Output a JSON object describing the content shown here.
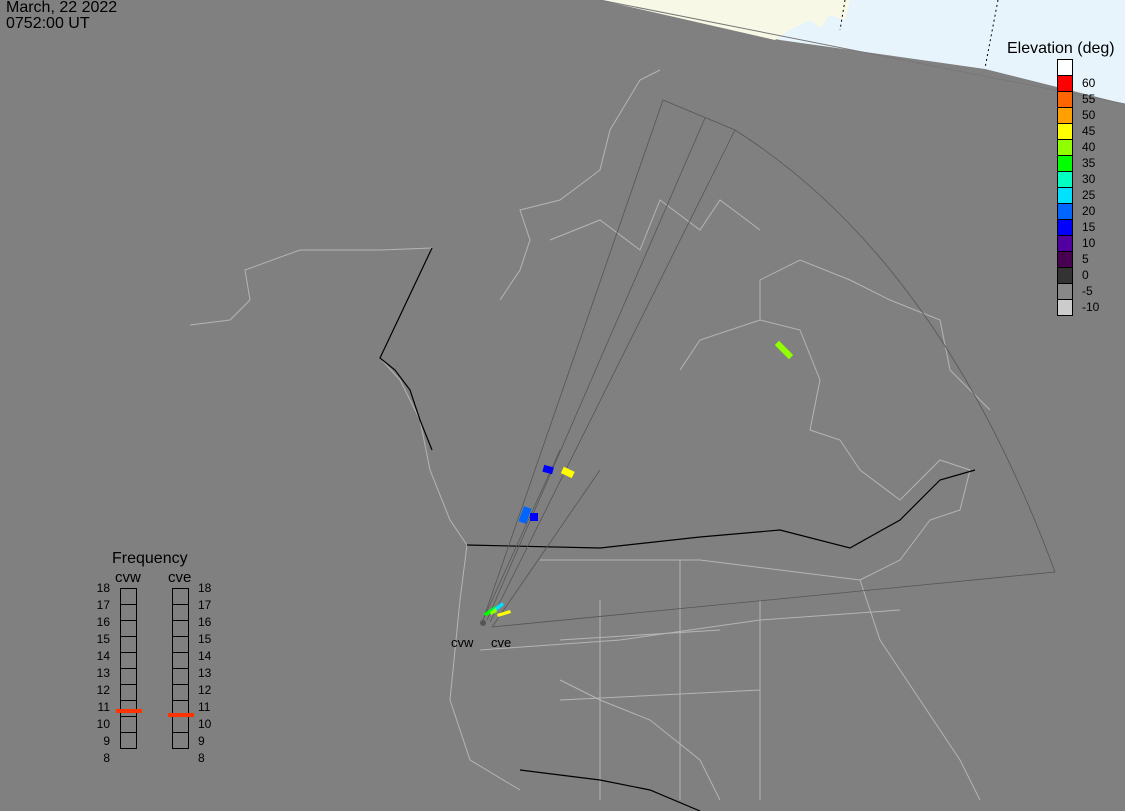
{
  "header": {
    "date": "March, 22 2022",
    "time": "0752:00 UT"
  },
  "elevation_legend": {
    "title": "Elevation (deg)",
    "cells": [
      {
        "color": "#ffffff",
        "label": ""
      },
      {
        "color": "#ff0000",
        "label": "60"
      },
      {
        "color": "#ff6600",
        "label": "55"
      },
      {
        "color": "#ffa000",
        "label": "50"
      },
      {
        "color": "#ffff00",
        "label": "45"
      },
      {
        "color": "#90ff00",
        "label": "40"
      },
      {
        "color": "#00ff00",
        "label": "35"
      },
      {
        "color": "#00ffc0",
        "label": "30"
      },
      {
        "color": "#00e0ff",
        "label": "25"
      },
      {
        "color": "#0066ff",
        "label": "20"
      },
      {
        "color": "#0000ff",
        "label": "15"
      },
      {
        "color": "#5000a0",
        "label": "10"
      },
      {
        "color": "#480050",
        "label": "5"
      },
      {
        "color": "#333333",
        "label": "0"
      },
      {
        "color": "#888888",
        "label": "-5"
      },
      {
        "color": "#cccccc",
        "label": "-10"
      }
    ]
  },
  "frequency": {
    "title": "Frequency",
    "unit_ticks": [
      "18",
      "17",
      "16",
      "15",
      "14",
      "13",
      "12",
      "11",
      "10",
      "9",
      "8"
    ],
    "radars": [
      {
        "name": "cvw",
        "freq_mhz": 10.8
      },
      {
        "name": "cve",
        "freq_mhz": 10.6
      }
    ],
    "marker_color": "#ff3300"
  },
  "sites": [
    {
      "name": "cvw"
    },
    {
      "name": "cve"
    }
  ],
  "colors": {
    "night": "#808080",
    "day_land": "#f8f8e6",
    "day_ocean": "#e8f4fc",
    "coast": "#b0b0b0"
  }
}
